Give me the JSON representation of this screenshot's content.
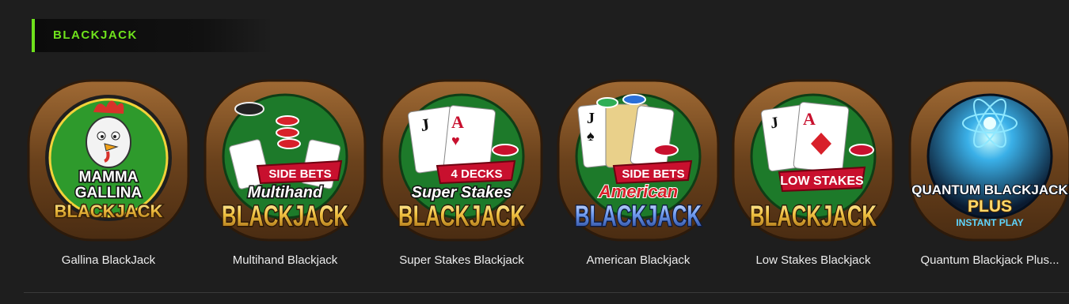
{
  "section": {
    "title": "BLACKJACK"
  },
  "games": [
    {
      "name": "Gallina BlackJack",
      "art": {
        "line1": "MAMMA",
        "line2": "GALLINA",
        "line3": "BLACKJACK",
        "felt": "#2e9a2c",
        "mascot": "rooster-mascot"
      }
    },
    {
      "name": "Multihand Blackjack",
      "art": {
        "ribbon": "SIDE BETS",
        "script": "Multihand",
        "word": "BLACKJACK",
        "felt": "#1d7a2a"
      }
    },
    {
      "name": "Super Stakes Blackjack",
      "art": {
        "ribbon": "4 DECKS",
        "script": "Super Stakes",
        "word": "BLACKJACK",
        "felt": "#1d7a2a"
      }
    },
    {
      "name": "American Blackjack",
      "art": {
        "ribbon": "SIDE BETS",
        "script": "American",
        "word": "BLACKJACK",
        "felt": "#1d7a2a"
      }
    },
    {
      "name": "Low Stakes Blackjack",
      "art": {
        "ribbon": "LOW STAKES",
        "word": "BLACKJACK",
        "felt": "#1d7a2a"
      }
    },
    {
      "name": "Quantum Blackjack Plus...",
      "art": {
        "line1": "QUANTUM BLACKJACK",
        "line2": "PLUS",
        "line3": "INSTANT PLAY",
        "felt": "#0e2440"
      }
    }
  ],
  "colors": {
    "accent": "#6fe21c",
    "wood": "#8a5a2b",
    "gold": "#f0c040",
    "ribbon": "#c8102e",
    "american_blue": "#3a6fd8",
    "quantum_cyan": "#5fd6ff"
  }
}
